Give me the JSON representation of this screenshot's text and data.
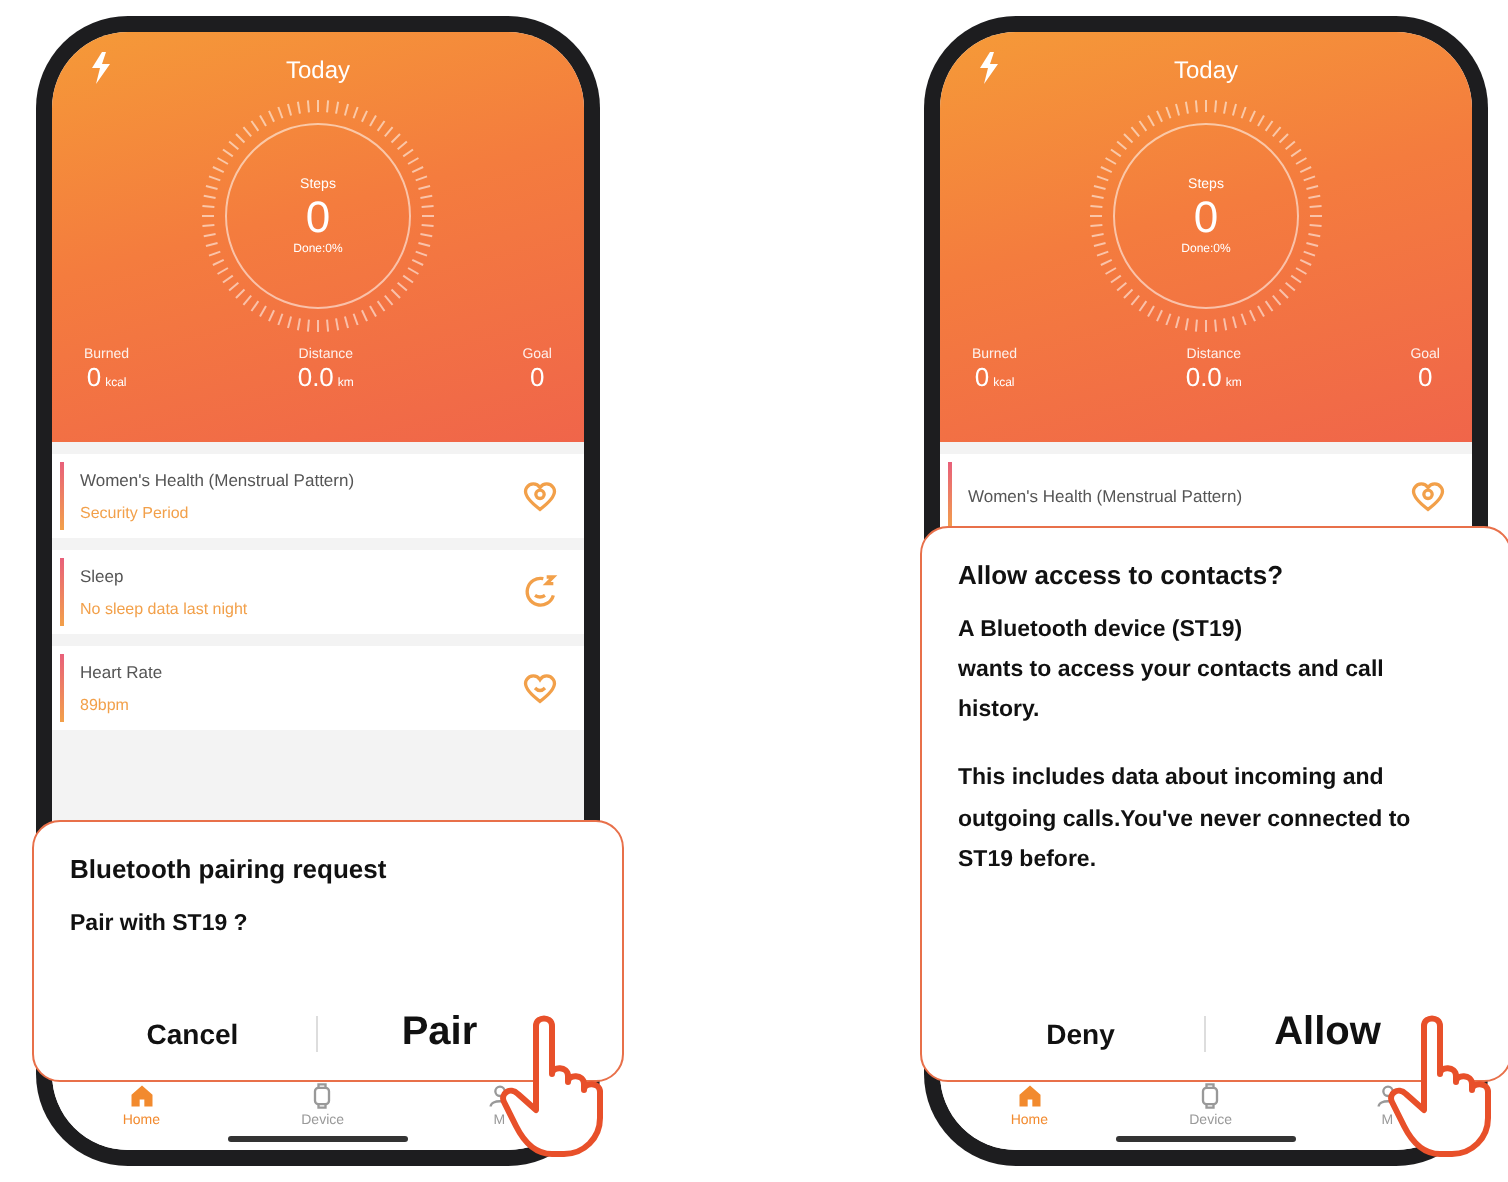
{
  "phones": [
    {
      "header": {
        "title": "Today",
        "ring": {
          "label": "Steps",
          "value": "0",
          "progress": "Done:0%"
        },
        "stats": [
          {
            "label": "Burned",
            "value": "0",
            "unit": "kcal"
          },
          {
            "label": "Distance",
            "value": "0.0",
            "unit": "km"
          },
          {
            "label": "Goal",
            "value": "0"
          }
        ]
      },
      "cards": [
        {
          "kind": "womens-health",
          "title": "Women's Health (Menstrual Pattern)",
          "subtitle": "Security Period"
        },
        {
          "kind": "sleep",
          "title": "Sleep",
          "subtitle": "No sleep data last night"
        },
        {
          "kind": "heart-rate",
          "title": "Heart Rate",
          "subtitle": "89bpm"
        }
      ],
      "nav": [
        {
          "kind": "home",
          "label": "Home",
          "selected": true
        },
        {
          "kind": "device",
          "label": "Device",
          "selected": false
        },
        {
          "kind": "me",
          "label": "M",
          "selected": false
        }
      ],
      "dialog": {
        "kind": "pairing",
        "title": "Bluetooth pairing request",
        "paragraphs": [
          "Pair with ST19 ?"
        ],
        "buttons": [
          {
            "label": "Cancel",
            "primary": false
          },
          {
            "label": "Pair",
            "primary": true
          }
        ]
      }
    },
    {
      "header": {
        "title": "Today",
        "ring": {
          "label": "Steps",
          "value": "0",
          "progress": "Done:0%"
        },
        "stats": [
          {
            "label": "Burned",
            "value": "0",
            "unit": "kcal"
          },
          {
            "label": "Distance",
            "value": "0.0",
            "unit": "km"
          },
          {
            "label": "Goal",
            "value": "0"
          }
        ]
      },
      "cards": [
        {
          "kind": "womens-health",
          "title": "Women's Health (Menstrual Pattern)"
        }
      ],
      "nav": [
        {
          "kind": "home",
          "label": "Home",
          "selected": true
        },
        {
          "kind": "device",
          "label": "Device",
          "selected": false
        },
        {
          "kind": "me",
          "label": "M",
          "selected": false
        }
      ],
      "dialog": {
        "kind": "permission",
        "title": "Allow access to contacts?",
        "paragraphs": [
          "A Bluetooth device (ST19)\nwants to access your contacts and call history.",
          "This includes data about incoming and outgoing calls.You've never connected to ST19 before."
        ],
        "buttons": [
          {
            "label": "Deny",
            "primary": false
          },
          {
            "label": "Allow",
            "primary": true
          }
        ]
      }
    }
  ]
}
